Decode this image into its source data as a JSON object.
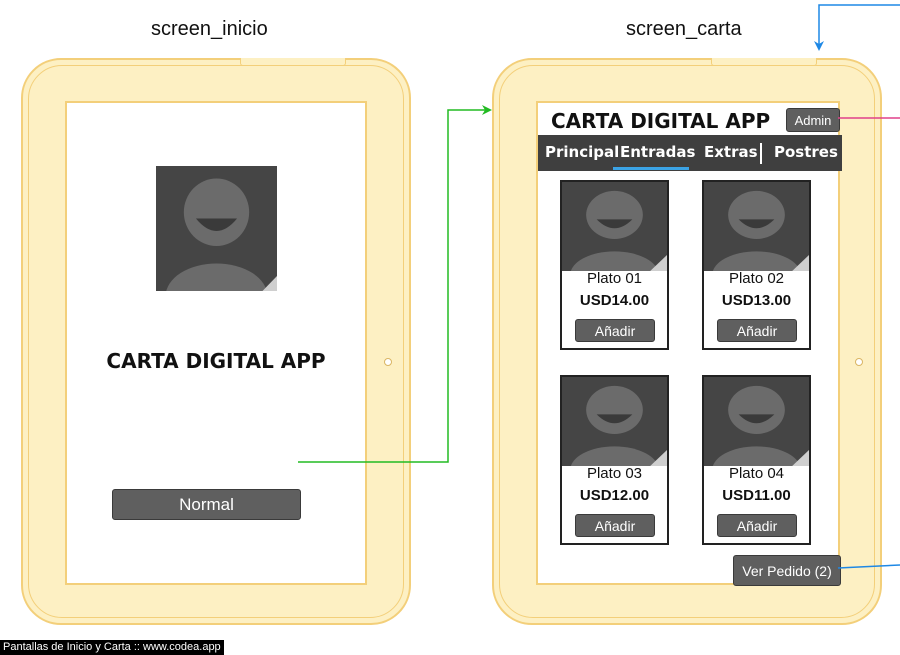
{
  "screens": [
    {
      "id": "inicio",
      "title": "screen_inicio",
      "app_title": "CARTA DIGITAL APP",
      "button_label": "Normal"
    },
    {
      "id": "carta",
      "title": "screen_carta",
      "app_title": "CARTA DIGITAL APP",
      "admin_label": "Admin",
      "tabs": [
        {
          "label": "Principal",
          "active": false
        },
        {
          "label": "Entradas",
          "active": true
        },
        {
          "label": "Extras",
          "active": false
        },
        {
          "label": "Postres",
          "active": false
        }
      ],
      "dishes": [
        {
          "name": "Plato 01",
          "price": "USD14.00",
          "button": "Añadir"
        },
        {
          "name": "Plato 02",
          "price": "USD13.00",
          "button": "Añadir"
        },
        {
          "name": "Plato 03",
          "price": "USD12.00",
          "button": "Añadir"
        },
        {
          "name": "Plato 04",
          "price": "USD11.00",
          "button": "Añadir"
        }
      ],
      "order_button": "Ver Pedido (2)"
    }
  ],
  "connectors": [
    {
      "from": "normal-button",
      "to": "screen_carta",
      "color": "#22bb22"
    },
    {
      "from": "offscreen",
      "to": "screen_carta",
      "color": "#1e88e5"
    },
    {
      "from": "admin-button",
      "to": "offscreen",
      "color": "#e0408a"
    },
    {
      "from": "ver-pedido-button",
      "to": "offscreen",
      "color": "#1e88e5"
    }
  ],
  "colors": {
    "tablet_fill": "#fdf0c3",
    "tablet_border": "#f3cf7a",
    "nav_active_underline": "#3ba3e5",
    "button_fill": "#5f5f5f"
  },
  "caption": "Pantallas de Inicio y Carta :: www.codea.app"
}
